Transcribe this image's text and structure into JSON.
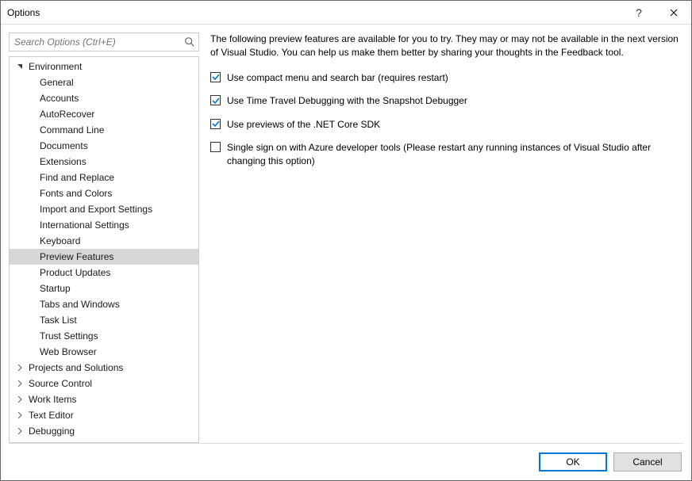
{
  "window": {
    "title": "Options"
  },
  "search": {
    "placeholder": "Search Options (Ctrl+E)"
  },
  "tree": {
    "env_label": "Environment",
    "children": [
      "General",
      "Accounts",
      "AutoRecover",
      "Command Line",
      "Documents",
      "Extensions",
      "Find and Replace",
      "Fonts and Colors",
      "Import and Export Settings",
      "International Settings",
      "Keyboard",
      "Preview Features",
      "Product Updates",
      "Startup",
      "Tabs and Windows",
      "Task List",
      "Trust Settings",
      "Web Browser"
    ],
    "selected_child": "Preview Features",
    "siblings": [
      "Projects and Solutions",
      "Source Control",
      "Work Items",
      "Text Editor",
      "Debugging"
    ]
  },
  "panel": {
    "description": "The following preview features are available for you to try. They may or may not be available in the next version of Visual Studio. You can help us make them better by sharing your thoughts in the Feedback tool.",
    "options": [
      {
        "label": "Use compact menu and search bar (requires restart)",
        "checked": true
      },
      {
        "label": "Use Time Travel Debugging with the Snapshot Debugger",
        "checked": true
      },
      {
        "label": "Use previews of the .NET Core SDK",
        "checked": true
      },
      {
        "label": "Single sign on with Azure developer tools (Please restart any running instances of Visual Studio after changing this option)",
        "checked": false
      }
    ]
  },
  "buttons": {
    "ok": "OK",
    "cancel": "Cancel"
  },
  "colors": {
    "accent": "#0078d7",
    "selection": "#d7d7d7"
  }
}
